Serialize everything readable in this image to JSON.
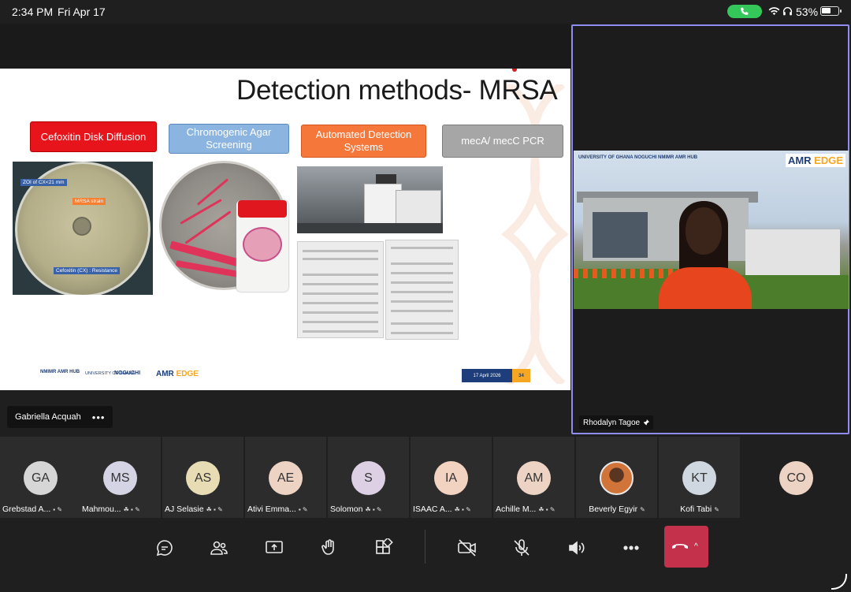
{
  "status": {
    "time": "2:34 PM",
    "date": "Fri Apr 17",
    "battery": "53%",
    "battery_level": 0.53
  },
  "slide": {
    "title": "Detection methods- MRSA",
    "methods": [
      "Cefoxitin Disk Diffusion",
      "Chromogenic Agar Screening",
      "Automated Detection Systems",
      "mecA/ mecC PCR"
    ],
    "petri_labels": [
      "ZOI of CX<21 mm",
      "MRSA strain",
      "Cefoxitin (CX) : Resistance"
    ],
    "footer": {
      "logo1": "NMIMR AMR HUB",
      "logo2": "UNIVERSITY OF GHANA",
      "logo3": "NOGUCHI",
      "logo4_a": "AMR ",
      "logo4_b": "EDGE",
      "date": "17 April 2026",
      "page": "34"
    }
  },
  "presenter": {
    "name": "Gabriella Acquah",
    "more": "•••"
  },
  "spotlight": {
    "name": "Rhodalyn Tagoe",
    "logo_left": "UNIVERSITY OF GHANA  NOGUCHI  NMIMR AMR HUB",
    "logo_right_a": "AMR ",
    "logo_right_b": "EDGE"
  },
  "participants": [
    {
      "initials": "GA",
      "name": "Grebstad A...",
      "icons": "▪ ✎",
      "color": "#d6d6d6"
    },
    {
      "initials": "MS",
      "name": "Mahmou...",
      "icons": "☘ ▪ ✎",
      "color": "#d4d4e4"
    },
    {
      "initials": "AS",
      "name": "AJ Selasie",
      "icons": "☘ ▪ ✎",
      "color": "#e8dcb4"
    },
    {
      "initials": "AE",
      "name": "Ativi Emma...",
      "icons": "▪ ✎",
      "color": "#ecd3c3"
    },
    {
      "initials": "S",
      "name": "Solomon",
      "icons": "☘ ▪ ✎",
      "color": "#ddd0e4"
    },
    {
      "initials": "IA",
      "name": "ISAAC A...",
      "icons": "☘ ▪ ✎",
      "color": "#f2d3c2"
    },
    {
      "initials": "AM",
      "name": "Achille M...",
      "icons": "☘ ▪ ✎",
      "color": "#ecd3c3"
    },
    {
      "initials": "",
      "name": "Beverly  Egyir",
      "icons": "✎",
      "color": "#d0743a"
    },
    {
      "initials": "KT",
      "name": "Kofi Tabi",
      "icons": "✎",
      "color": "#cfd8e0"
    },
    {
      "initials": "CO",
      "name": "",
      "icons": "",
      "color": "#ecd3c3"
    }
  ],
  "toolbar": {
    "buttons": [
      "chat",
      "people",
      "share",
      "raise-hand",
      "apps",
      "camera-off",
      "mic-off",
      "speaker",
      "more",
      "leave"
    ]
  },
  "colors": {
    "accent": "#8f8ef0",
    "leave": "#c4314b",
    "call_pill": "#34c759"
  }
}
